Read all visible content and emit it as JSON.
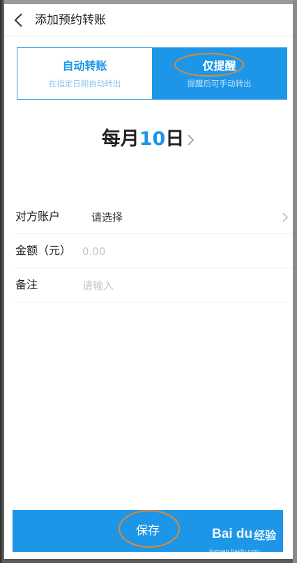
{
  "header": {
    "title": "添加预约转账"
  },
  "tabs": [
    {
      "title": "自动转账",
      "subtitle": "在指定日期自动转出",
      "selected": false
    },
    {
      "title": "仅提醒",
      "subtitle": "提醒后可手动转出",
      "selected": true
    }
  ],
  "schedule": {
    "prefix": "每月",
    "day": "10",
    "suffix": "日"
  },
  "form": {
    "account": {
      "label": "对方账户",
      "value": "请选择"
    },
    "amount": {
      "label": "金额（元）",
      "placeholder": "0.00"
    },
    "note": {
      "label": "备注",
      "placeholder": "请输入"
    }
  },
  "save_label": "保存",
  "watermark": {
    "logo": "Bai du",
    "label": "经验",
    "url": "jingyan.baidu.com"
  },
  "colors": {
    "accent": "#1e96e8",
    "annotation": "#e08a2e"
  }
}
